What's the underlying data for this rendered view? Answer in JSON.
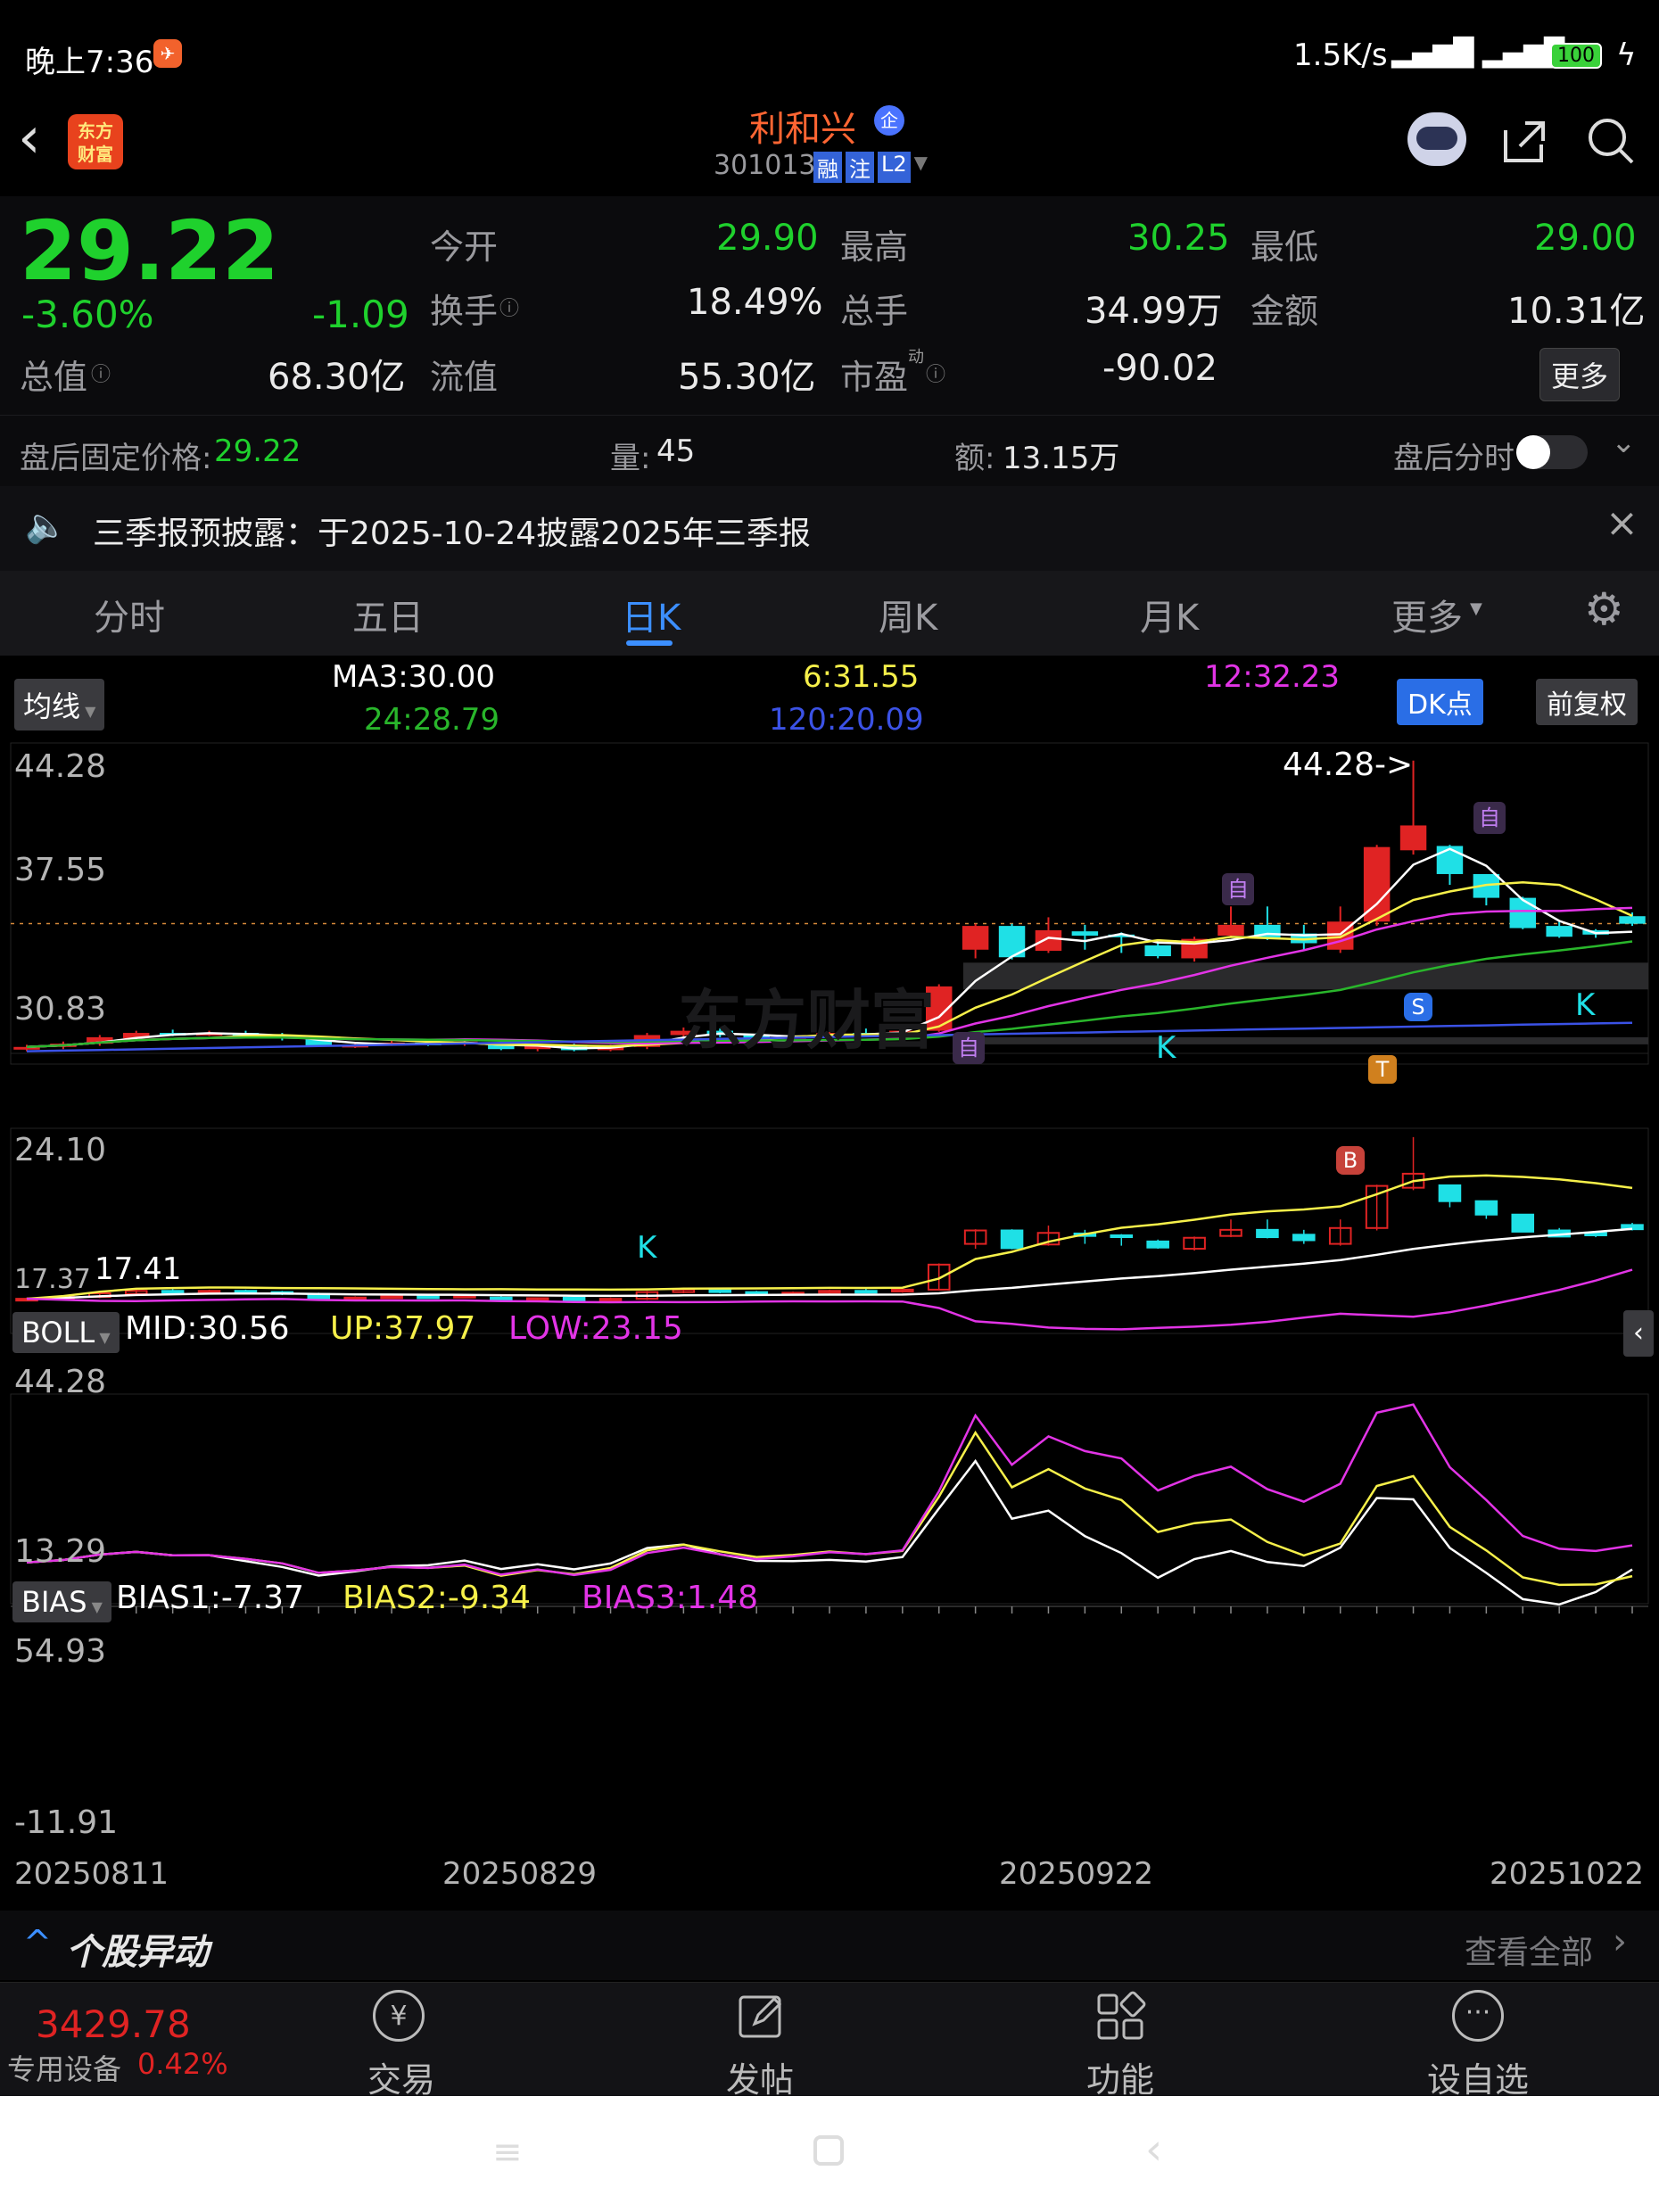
{
  "status_bar": {
    "time": "晚上7:36",
    "net_speed": "1.5K/s",
    "battery": "100"
  },
  "header": {
    "app_logo": "东方\n财富",
    "stock_name": "利和兴",
    "badge": "企",
    "stock_code": "301013",
    "tags": [
      "融",
      "注",
      "L2"
    ]
  },
  "quote": {
    "price": "29.22",
    "change_pct": "-3.60%",
    "change_abs": "-1.09",
    "open_label": "今开",
    "open": "29.90",
    "high_label": "最高",
    "high": "30.25",
    "low_label": "最低",
    "low": "29.00",
    "turnover_label": "换手",
    "turnover": "18.49%",
    "volume_label": "总手",
    "volume": "34.99万",
    "amount_label": "金额",
    "amount": "10.31亿",
    "mktcap_label": "总值",
    "mktcap": "68.30亿",
    "float_label": "流值",
    "float": "55.30亿",
    "pe_label": "市盈",
    "pe_sup": "动",
    "pe": "-90.02",
    "more_button": "更多"
  },
  "after_hours": {
    "price_label": "盘后固定价格:",
    "price": "29.22",
    "vol_label": "量:",
    "vol": "45",
    "amt_label": "额:",
    "amt": "13.15万",
    "toggle_label": "盘后分时"
  },
  "notice": {
    "text": "三季报预披露：于2025-10-24披露2025年三季报"
  },
  "tabs": [
    "分时",
    "五日",
    "日K",
    "周K",
    "月K",
    "更多"
  ],
  "ma_bar": {
    "selector": "均线",
    "ma3": "MA3:30.00",
    "ma6": "6:31.55",
    "ma12": "12:32.23",
    "ma24": "24:28.79",
    "ma120": "120:20.09",
    "dk_button": "DK点",
    "fq_button": "前复权"
  },
  "main_axis": {
    "y_top": "44.28",
    "y2": "37.55",
    "y3": "30.83",
    "y4": "24.10",
    "y_bottom": "17.37",
    "max_note": "44.28->",
    "min_note": "17.41"
  },
  "boll_bar": {
    "selector": "BOLL",
    "mid": "MID:30.56",
    "up": "UP:37.97",
    "low": "LOW:23.15",
    "y_top": "44.28",
    "y_bottom": "13.29"
  },
  "bias_bar": {
    "selector": "BIAS",
    "b1": "BIAS1:-7.37",
    "b2": "BIAS2:-9.34",
    "b3": "BIAS3:1.48",
    "y_top": "54.93",
    "y_bottom": "-11.91"
  },
  "x_axis": {
    "d1": "20250811",
    "d2": "20250829",
    "d3": "20250922",
    "d4": "20251022"
  },
  "markers": {
    "self": "自",
    "k": "K",
    "s": "S",
    "b": "B",
    "t": "T",
    "watermark": "东方财富"
  },
  "movement": {
    "title": "个股异动",
    "view_all": "查看全部"
  },
  "bottom": {
    "index_value": "3429.78",
    "sector": "专用设备",
    "sector_pct": "0.42%",
    "trade": "交易",
    "post": "发帖",
    "func": "功能",
    "watch": "设自选"
  },
  "colors": {
    "up": "#e02323",
    "down": "#1fe0e6",
    "ma3": "#ffffff",
    "ma6": "#f6f04a",
    "ma12": "#e234e6",
    "ma24": "#29b62b",
    "ma120": "#3b52e6"
  },
  "chart_data": {
    "type": "candlestick",
    "dates_shown": [
      "20250811",
      "20250829",
      "20250922",
      "20251022"
    ],
    "ylim": [
      17.37,
      44.28
    ],
    "candles": [
      {
        "o": 17.6,
        "c": 17.8,
        "h": 18.0,
        "l": 17.4
      },
      {
        "o": 17.8,
        "c": 18.1,
        "h": 18.3,
        "l": 17.6
      },
      {
        "o": 18.1,
        "c": 18.7,
        "h": 18.9,
        "l": 17.9
      },
      {
        "o": 18.6,
        "c": 19.1,
        "h": 19.3,
        "l": 18.4
      },
      {
        "o": 19.1,
        "c": 19.0,
        "h": 19.4,
        "l": 18.8
      },
      {
        "o": 19.0,
        "c": 19.1,
        "h": 19.3,
        "l": 18.8
      },
      {
        "o": 19.1,
        "c": 18.9,
        "h": 19.3,
        "l": 18.7
      },
      {
        "o": 18.9,
        "c": 18.6,
        "h": 19.1,
        "l": 18.4
      },
      {
        "o": 18.6,
        "c": 17.9,
        "h": 18.8,
        "l": 17.8
      },
      {
        "o": 17.9,
        "c": 18.0,
        "h": 18.2,
        "l": 17.7
      },
      {
        "o": 18.0,
        "c": 18.2,
        "h": 18.4,
        "l": 17.9
      },
      {
        "o": 18.2,
        "c": 18.1,
        "h": 18.4,
        "l": 17.9
      },
      {
        "o": 18.1,
        "c": 18.3,
        "h": 18.5,
        "l": 17.9
      },
      {
        "o": 18.0,
        "c": 17.6,
        "h": 18.3,
        "l": 17.5
      },
      {
        "o": 17.6,
        "c": 17.9,
        "h": 18.0,
        "l": 17.4
      },
      {
        "o": 18.0,
        "c": 17.5,
        "h": 18.1,
        "l": 17.4
      },
      {
        "o": 17.5,
        "c": 17.8,
        "h": 18.0,
        "l": 17.4
      },
      {
        "o": 17.8,
        "c": 18.9,
        "h": 19.1,
        "l": 17.6
      },
      {
        "o": 18.9,
        "c": 19.3,
        "h": 19.6,
        "l": 18.7
      },
      {
        "o": 19.3,
        "c": 18.9,
        "h": 19.5,
        "l": 18.7
      },
      {
        "o": 18.9,
        "c": 18.6,
        "h": 19.1,
        "l": 18.4
      },
      {
        "o": 18.6,
        "c": 18.8,
        "h": 19.0,
        "l": 18.4
      },
      {
        "o": 18.8,
        "c": 19.1,
        "h": 19.3,
        "l": 18.6
      },
      {
        "o": 19.1,
        "c": 19.0,
        "h": 19.5,
        "l": 18.8
      },
      {
        "o": 19.0,
        "c": 19.3,
        "h": 19.5,
        "l": 18.8
      },
      {
        "o": 19.3,
        "c": 23.4,
        "h": 23.6,
        "l": 19.2
      },
      {
        "o": 26.8,
        "c": 29.0,
        "h": 29.2,
        "l": 26.0
      },
      {
        "o": 29.0,
        "c": 26.1,
        "h": 29.2,
        "l": 25.9
      },
      {
        "o": 26.7,
        "c": 28.6,
        "h": 29.8,
        "l": 26.5
      },
      {
        "o": 28.5,
        "c": 28.1,
        "h": 29.1,
        "l": 26.8
      },
      {
        "o": 28.2,
        "c": 28.1,
        "h": 28.4,
        "l": 26.5
      },
      {
        "o": 27.2,
        "c": 26.2,
        "h": 27.5,
        "l": 26.0
      },
      {
        "o": 26.0,
        "c": 27.8,
        "h": 28.0,
        "l": 25.7
      },
      {
        "o": 28.1,
        "c": 29.1,
        "h": 30.8,
        "l": 27.9
      },
      {
        "o": 29.1,
        "c": 27.9,
        "h": 30.8,
        "l": 27.7
      },
      {
        "o": 28.3,
        "c": 27.4,
        "h": 29.1,
        "l": 26.8
      },
      {
        "o": 26.8,
        "c": 29.4,
        "h": 30.8,
        "l": 26.5
      },
      {
        "o": 29.4,
        "c": 36.3,
        "h": 36.5,
        "l": 29.0
      },
      {
        "o": 36.0,
        "c": 38.3,
        "h": 44.3,
        "l": 35.6
      },
      {
        "o": 36.4,
        "c": 33.8,
        "h": 36.5,
        "l": 32.8
      },
      {
        "o": 33.8,
        "c": 31.6,
        "h": 33.8,
        "l": 30.9
      },
      {
        "o": 31.6,
        "c": 28.8,
        "h": 31.7,
        "l": 28.7
      },
      {
        "o": 29.0,
        "c": 28.0,
        "h": 29.4,
        "l": 27.9
      },
      {
        "o": 28.6,
        "c": 28.2,
        "h": 28.7,
        "l": 27.9
      },
      {
        "o": 29.9,
        "c": 29.2,
        "h": 30.25,
        "l": 29.0
      }
    ],
    "boll": {
      "mid": "30.56",
      "up": "37.97",
      "low": "23.15",
      "ylim": [
        13.29,
        44.28
      ]
    },
    "bias": {
      "bias1": -7.37,
      "bias2": -9.34,
      "bias3": 1.48,
      "ylim": [
        -11.91,
        54.93
      ]
    }
  }
}
